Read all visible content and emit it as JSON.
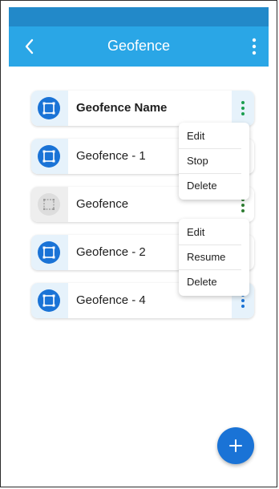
{
  "header": {
    "title": "Geofence",
    "back_icon": "chevron-left-icon",
    "more_icon": "more-vertical-icon"
  },
  "geofences": [
    {
      "name": "Geofence Name",
      "active": true
    },
    {
      "name": "Geofence - 1",
      "active": true
    },
    {
      "name": "Geofence",
      "active": false
    },
    {
      "name": "Geofence - 2",
      "active": true
    },
    {
      "name": "Geofence - 4",
      "active": true
    }
  ],
  "menus": {
    "active_menu": {
      "items": [
        "Edit",
        "Stop",
        "Delete"
      ]
    },
    "inactive_menu": {
      "items": [
        "Edit",
        "Resume",
        "Delete"
      ]
    }
  },
  "fab": {
    "icon": "plus-icon"
  },
  "colors": {
    "status_bar": "#2289c9",
    "app_bar": "#2aa6e6",
    "accent": "#1a73d6",
    "inactive_icon": "#dddddd",
    "kebab_active": "#1a9e4f",
    "kebab_inactive": "#2e7d32"
  }
}
